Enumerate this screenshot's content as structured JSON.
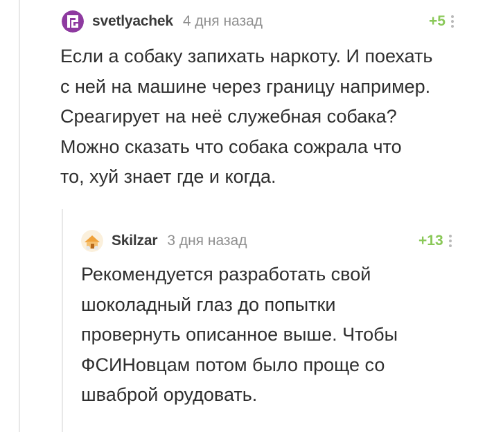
{
  "comments": [
    {
      "username": "svetlyachek",
      "timestamp": "4 дня назад",
      "rating": "+5",
      "avatar_icon": "purple-pixel-logo-avatar",
      "accent_color": "#8e3aa0",
      "body": "Если а собаку запихать наркоту. И поехать\nс ней на машине через границу например.\nСреагирует на неё служебная собака?\nМожно сказать что собака сожрала что\nто, хуй знает где и когда."
    },
    {
      "username": "Skilzar",
      "timestamp": "3 дня назад",
      "rating": "+13",
      "avatar_icon": "orange-house-avatar",
      "accent_color": "#f0a23a",
      "body": "Рекомендуется разработать свой\nшоколадный глаз до попытки\nпровернуть описанное выше. Чтобы\nФСИНовцам потом было проще со\nшваброй орудовать."
    }
  ],
  "rating_color": "#8ac858"
}
